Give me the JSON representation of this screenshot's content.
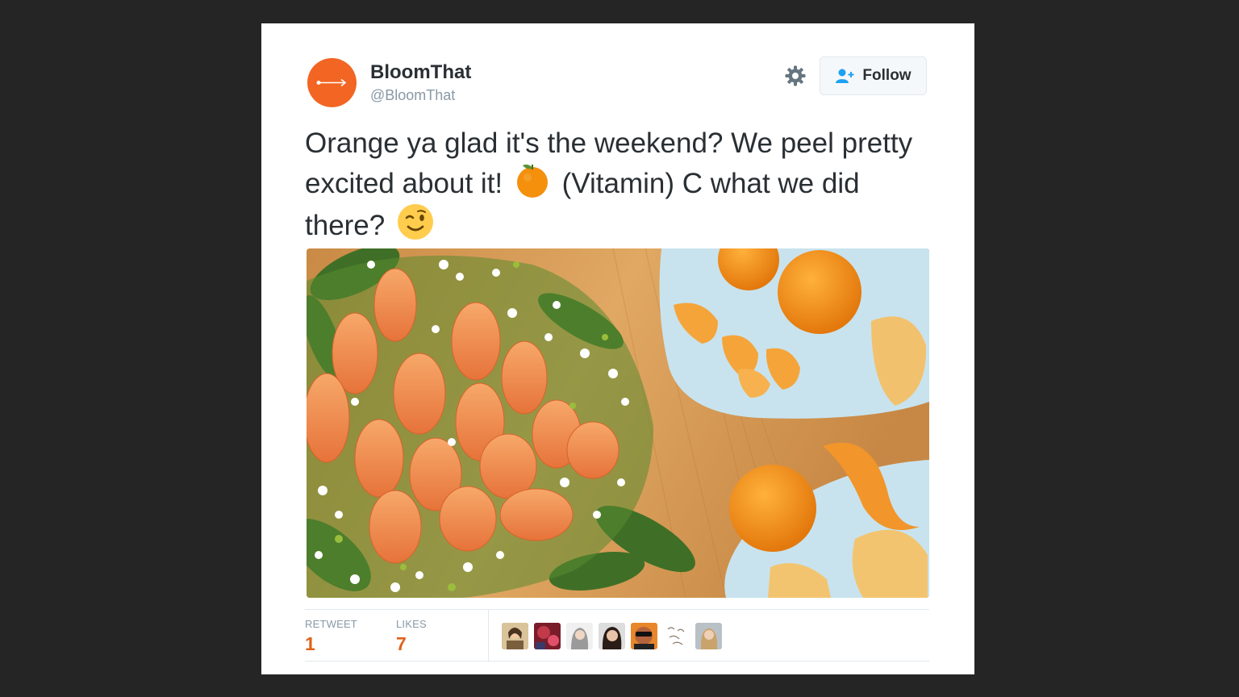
{
  "user": {
    "name": "BloomThat",
    "handle": "@BloomThat",
    "avatar_color": "#f26522"
  },
  "actions": {
    "follow_label": "Follow",
    "settings_icon": "gear-icon",
    "follow_icon": "add-user-icon"
  },
  "tweet": {
    "text_part1": "Orange ya glad it's the weekend? We peel pretty excited about it!",
    "emoji1": "tangerine-emoji",
    "text_part2": "(Vitamin) C what we did there?",
    "emoji2": "winking-face-emoji"
  },
  "media": {
    "description": "tweet-photo"
  },
  "stats": {
    "retweet_label": "RETWEET",
    "retweet_count": "1",
    "likes_label": "LIKES",
    "likes_count": "7",
    "accent_color": "#e0621a"
  },
  "likers": [
    {
      "name": "liker-avatar-1"
    },
    {
      "name": "liker-avatar-2"
    },
    {
      "name": "liker-avatar-3"
    },
    {
      "name": "liker-avatar-4"
    },
    {
      "name": "liker-avatar-5"
    },
    {
      "name": "liker-avatar-6"
    },
    {
      "name": "liker-avatar-7"
    }
  ]
}
